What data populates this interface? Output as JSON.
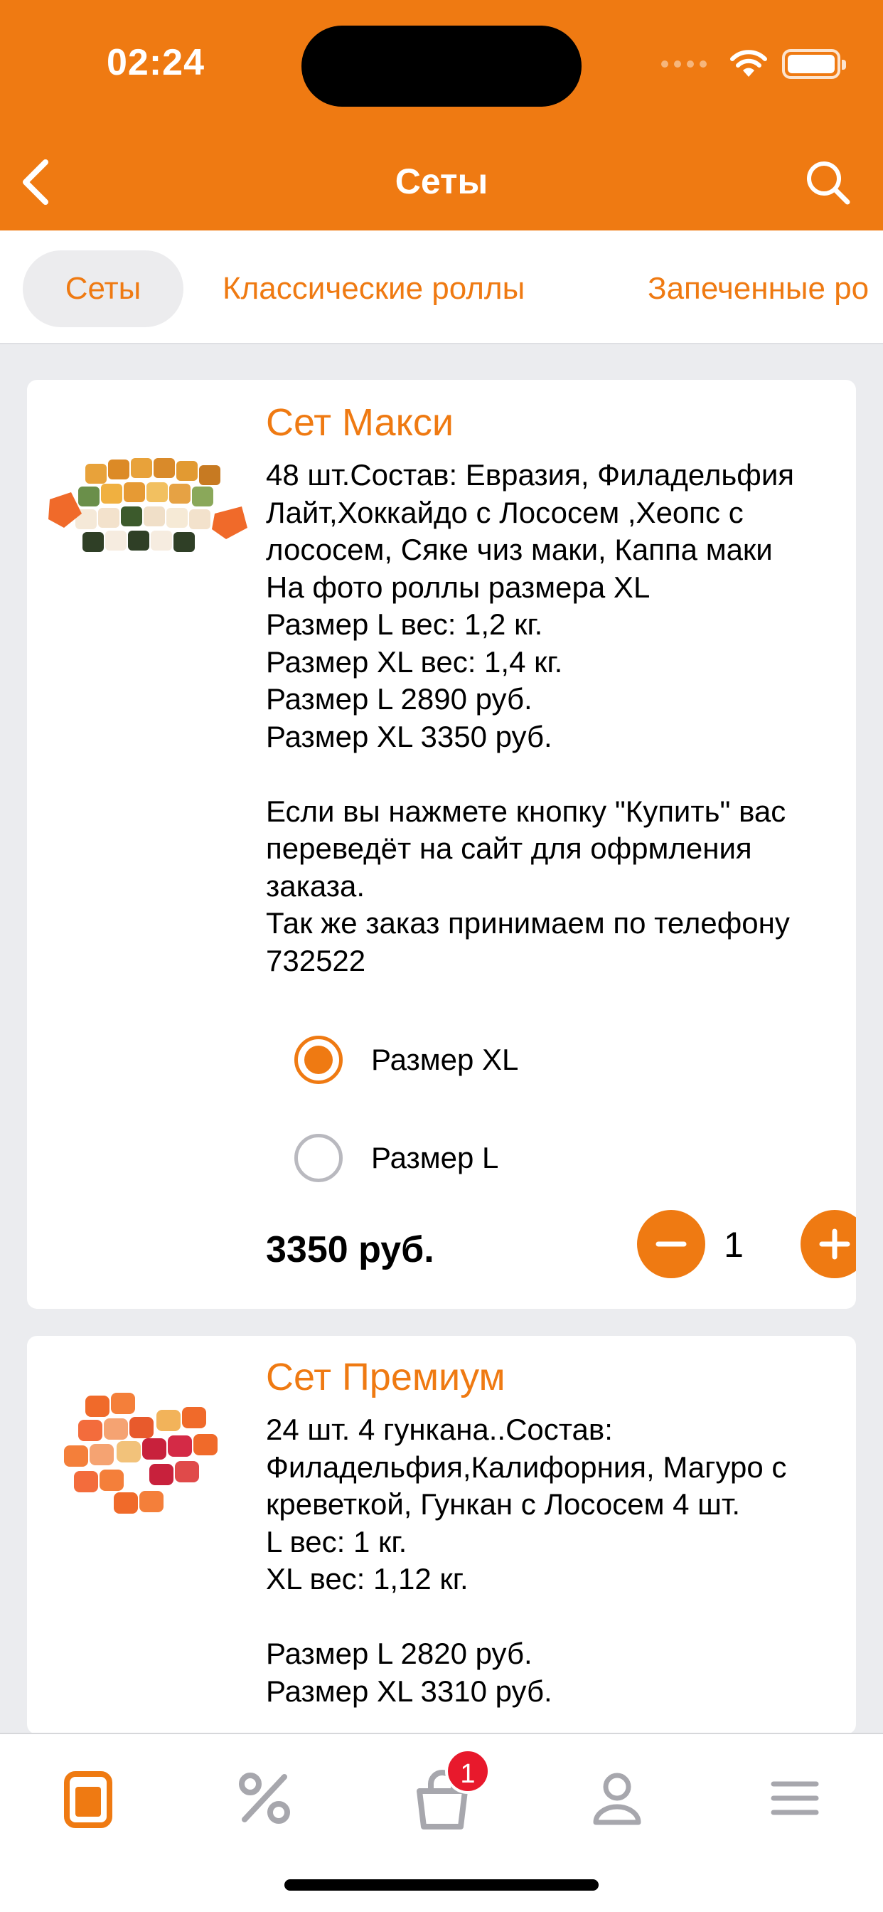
{
  "status_bar": {
    "time": "02:24"
  },
  "nav": {
    "title": "Сеты"
  },
  "tabs": [
    {
      "label": "Сеты",
      "active": true
    },
    {
      "label": "Классические роллы",
      "active": false
    },
    {
      "label": "Запеченные ро",
      "active": false
    }
  ],
  "products": [
    {
      "title": "Сет Макси",
      "description": "48 шт.Состав: Евразия, Филадельфия Лайт,Хоккайдо с Лососем ,Хеопс с лососем, Сяке чиз маки, Каппа маки\nНа фото роллы размера XL\nРазмер L вес: 1,2 кг.\nРазмер XL вес: 1,4 кг.\nРазмер L 2890 руб.\nРазмер XL 3350 руб.\n\nЕсли вы нажмете кнопку \"Купить\" вас переведёт на сайт для офрмления заказа.\nТак же заказ принимаем по телефону 732522",
      "options": [
        {
          "label": "Размер XL",
          "selected": true
        },
        {
          "label": "Размер L",
          "selected": false
        }
      ],
      "price": "3350 руб.",
      "quantity": "1"
    },
    {
      "title": "Сет Премиум",
      "description": "24 шт. 4 гункана..Состав: Филадельфия,Калифорния, Магуро с креветкой, Гункан с Лососем 4 шт.\nL вес: 1 кг.\nXL вес: 1,12 кг.\n\nРазмер L 2820 руб.\nРазмер XL 3310 руб."
    }
  ],
  "tabbar": {
    "items": [
      {
        "icon": "menu-catalog-icon",
        "active": true
      },
      {
        "icon": "percent-icon",
        "active": false
      },
      {
        "icon": "cart-icon",
        "active": false
      },
      {
        "icon": "profile-icon",
        "active": false
      },
      {
        "icon": "hamburger-icon",
        "active": false
      }
    ],
    "cart_badge": "1"
  },
  "colors": {
    "accent": "#ef7a12",
    "badge": "#e8192c",
    "inactive_icon": "#a7a7ad"
  }
}
